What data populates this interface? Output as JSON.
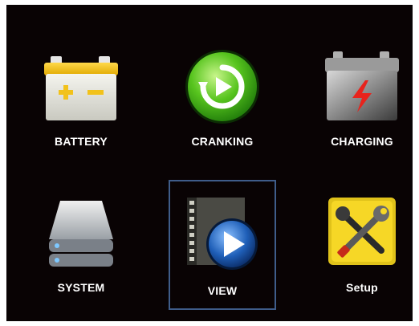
{
  "menu": {
    "items": [
      {
        "label": "BATTERY",
        "icon": "battery-icon"
      },
      {
        "label": "CRANKING",
        "icon": "cranking-icon"
      },
      {
        "label": "CHARGING",
        "icon": "charging-icon"
      },
      {
        "label": "SYSTEM",
        "icon": "system-icon"
      },
      {
        "label": "VIEW",
        "icon": "view-icon",
        "selected": true
      },
      {
        "label": "Setup",
        "icon": "setup-icon"
      }
    ]
  },
  "colors": {
    "background": "#090304",
    "selection_border": "#3f5d8a",
    "label": "#ffffff"
  }
}
